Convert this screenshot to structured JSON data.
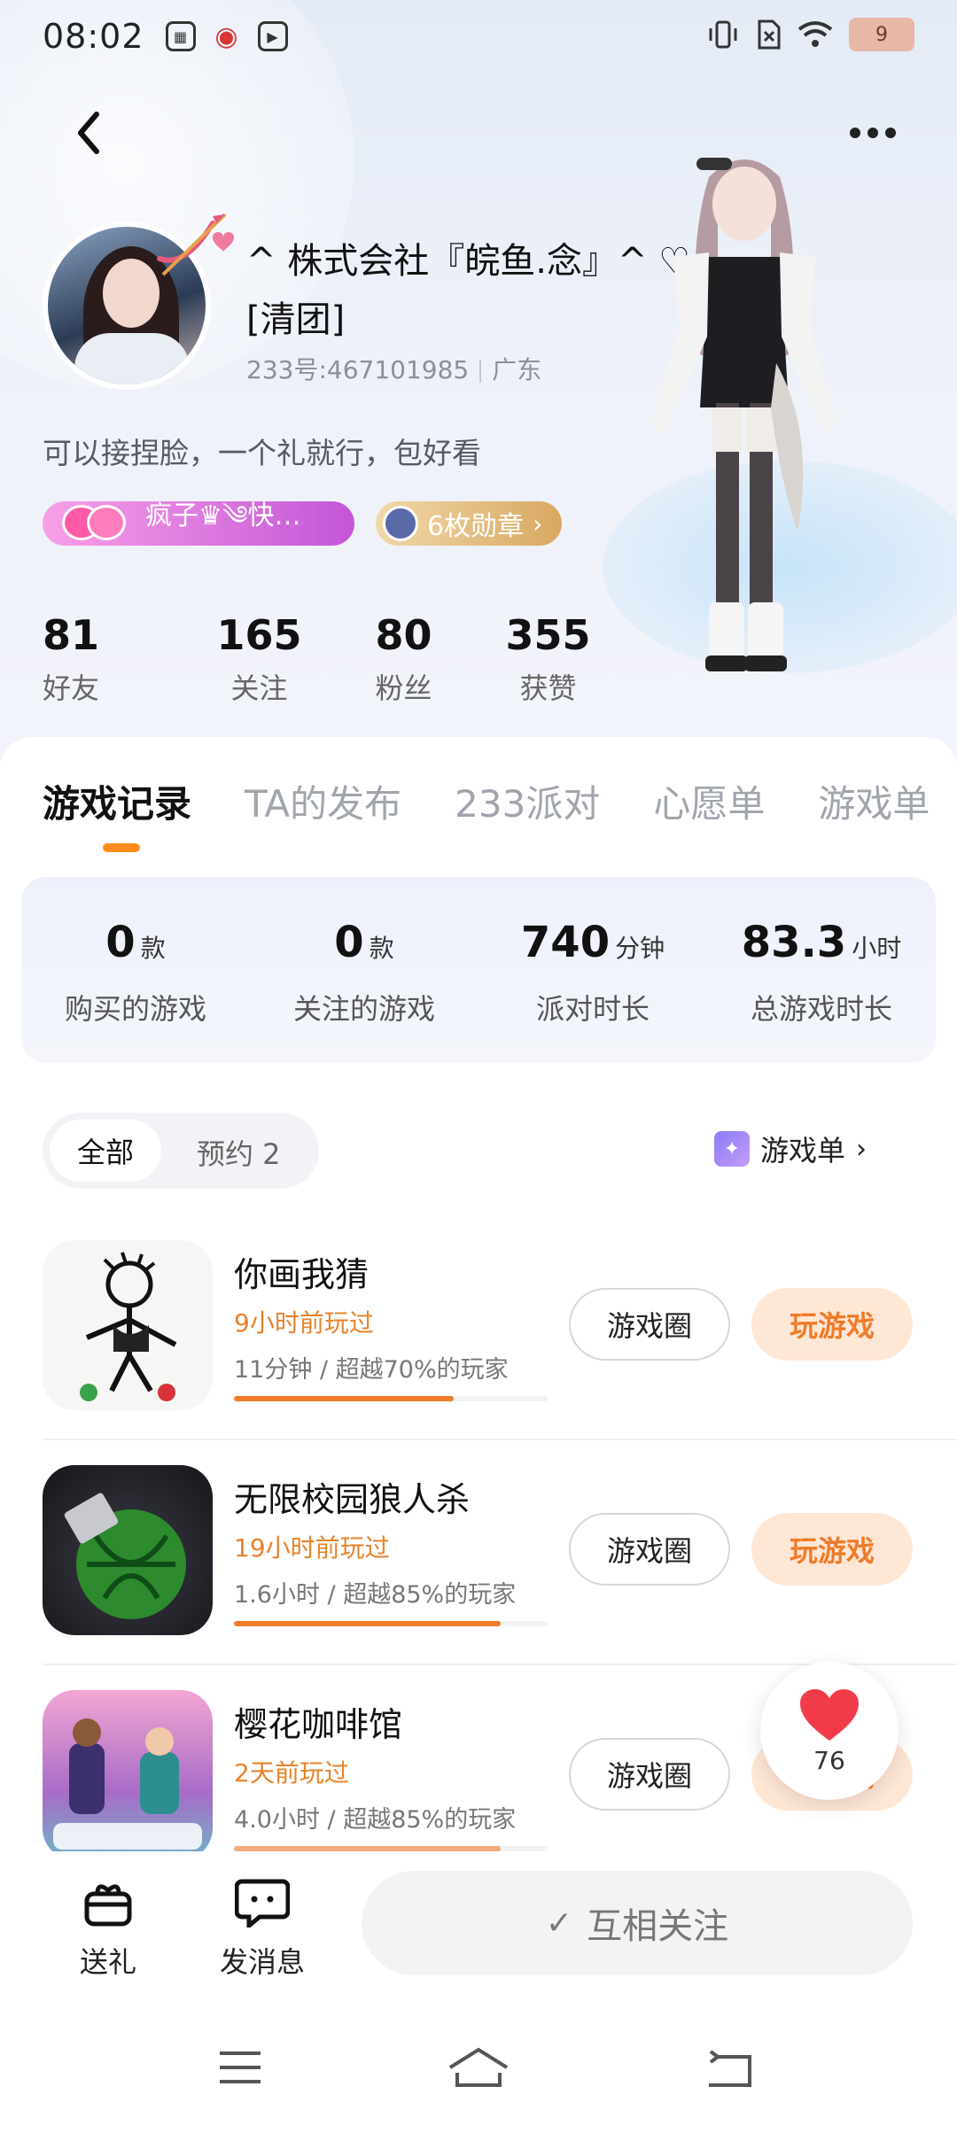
{
  "status_bar": {
    "time": "08:02",
    "battery": "9"
  },
  "profile": {
    "name_line1": "^ 株式会社『皖鱼.念』^ ♡.",
    "name_line2": "[清团]",
    "id": "233号:467101985",
    "region": "广东",
    "bio": "可以接捏脸，一个礼就行，包好看",
    "fan_tag": "疯子♛༄快…",
    "medal_tag": "6枚勋章",
    "stats": [
      {
        "value": "81",
        "label": "好友"
      },
      {
        "value": "165",
        "label": "关注"
      },
      {
        "value": "80",
        "label": "粉丝"
      },
      {
        "value": "355",
        "label": "获赞"
      }
    ]
  },
  "tabs": [
    "游戏记录",
    "TA的发布",
    "233派对",
    "心愿单",
    "游戏单"
  ],
  "summary": [
    {
      "value": "0",
      "unit": "款",
      "label": "购买的游戏"
    },
    {
      "value": "0",
      "unit": "款",
      "label": "关注的游戏"
    },
    {
      "value": "740",
      "unit": "分钟",
      "label": "派对时长"
    },
    {
      "value": "83.3",
      "unit": "小时",
      "label": "总游戏时长"
    }
  ],
  "filter": {
    "all": "全部",
    "reserve": "预约 2",
    "game_list": "游戏单"
  },
  "games": [
    {
      "title": "你画我猜",
      "played": "9小时前玩过",
      "meta": "11分钟 / 超越70%的玩家",
      "progress": 0.7,
      "circle_label": "游戏圈",
      "play_label": "玩游戏"
    },
    {
      "title": "无限校园狼人杀",
      "played": "19小时前玩过",
      "meta": "1.6小时 / 超越85%的玩家",
      "progress": 0.85,
      "circle_label": "游戏圈",
      "play_label": "玩游戏"
    },
    {
      "title": "樱花咖啡馆",
      "played": "2天前玩过",
      "meta": "4.0小时 / 超越85%的玩家",
      "progress": 0.85,
      "circle_label": "游戏圈",
      "play_label": "玩游戏"
    }
  ],
  "like_count": "76",
  "actions": {
    "gift": "送礼",
    "message": "发消息",
    "follow": "互相关注"
  },
  "colors": {
    "accent": "#f07b2a",
    "play_bg": "#ffe7d6",
    "fan_tag": "#c356d8",
    "medal_tag": "#d8a862"
  }
}
